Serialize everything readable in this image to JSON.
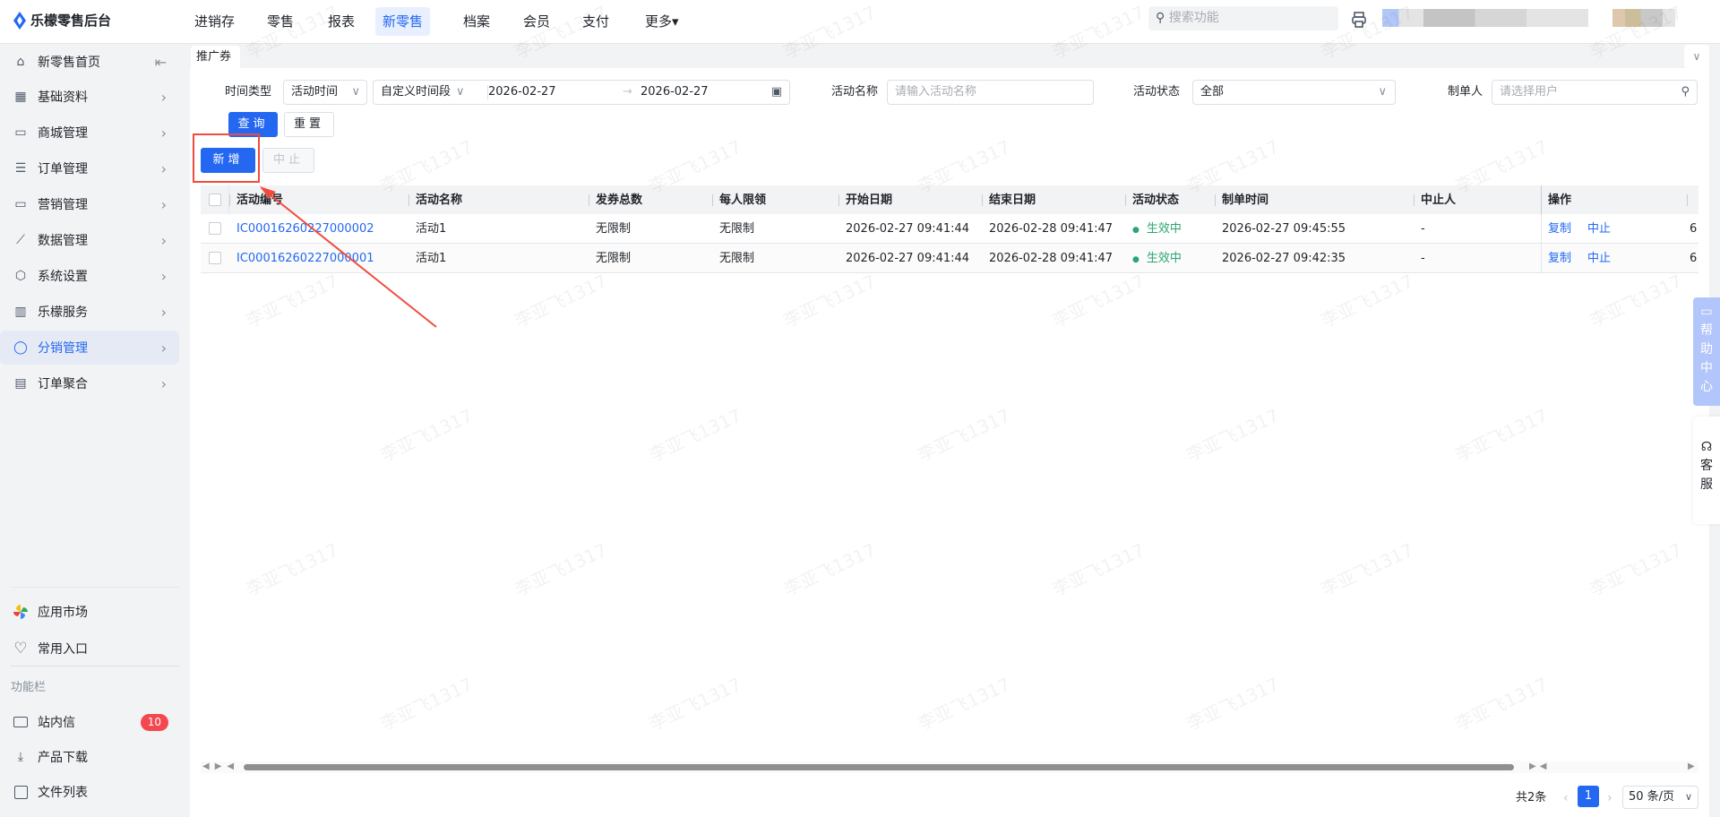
{
  "app": {
    "title": "乐檬零售后台"
  },
  "topnav": [
    {
      "label": "进销存"
    },
    {
      "label": "零售"
    },
    {
      "label": "报表"
    },
    {
      "label": "新零售",
      "active": true
    },
    {
      "label": "档案"
    },
    {
      "label": "会员"
    },
    {
      "label": "支付"
    },
    {
      "label": "更多▾"
    }
  ],
  "search": {
    "placeholder": "搜索功能"
  },
  "sidebar": {
    "items": [
      {
        "label": "新零售首页",
        "icon": "home-icon"
      },
      {
        "label": "基础资料",
        "icon": "grid-icon"
      },
      {
        "label": "商城管理",
        "icon": "store-icon"
      },
      {
        "label": "订单管理",
        "icon": "order-icon"
      },
      {
        "label": "营销管理",
        "icon": "marketing-icon"
      },
      {
        "label": "数据管理",
        "icon": "chart-icon"
      },
      {
        "label": "系统设置",
        "icon": "settings-icon"
      },
      {
        "label": "乐檬服务",
        "icon": "briefcase-icon"
      },
      {
        "label": "分销管理",
        "icon": "distribution-icon",
        "active": true
      },
      {
        "label": "订单聚合",
        "icon": "order-aggregate-icon"
      }
    ],
    "bottom": {
      "app_market": "应用市场",
      "favorites": "常用入口",
      "section": "功能栏",
      "messages": "站内信",
      "messages_badge": "10",
      "downloads": "产品下载",
      "files": "文件列表"
    }
  },
  "tab": {
    "label": "推广券"
  },
  "filters": {
    "time_type_label": "时间类型",
    "time_type_value": "活动时间",
    "range_type": "自定义时间段",
    "start_date": "2026-02-27",
    "end_date": "2026-02-27",
    "range_sep": "→",
    "name_label": "活动名称",
    "name_placeholder": "请输入活动名称",
    "status_label": "活动状态",
    "status_value": "全部",
    "creator_label": "制单人",
    "creator_placeholder": "请选择用户",
    "query": "查询",
    "reset": "重置"
  },
  "actions": {
    "add": "新增",
    "stop": "中止"
  },
  "table": {
    "columns": [
      "活动编号",
      "活动名称",
      "发券总数",
      "每人限领",
      "开始日期",
      "结束日期",
      "活动状态",
      "制单时间",
      "中止人",
      "操作"
    ],
    "rows": [
      {
        "id": "IC00016260227000002",
        "name": "活动1",
        "total": "无限制",
        "limit": "无限制",
        "start": "2026-02-27 09:41:44",
        "end": "2026-02-28 09:41:47",
        "status": "生效中",
        "created": "2026-02-27 09:45:55",
        "stopper": "-",
        "op1": "复制",
        "op2": "中止",
        "extra": "6"
      },
      {
        "id": "IC00016260227000001",
        "name": "活动1",
        "total": "无限制",
        "limit": "无限制",
        "start": "2026-02-27 09:41:44",
        "end": "2026-02-28 09:41:47",
        "status": "生效中",
        "created": "2026-02-27 09:42:35",
        "stopper": "-",
        "op1": "复制",
        "op2": "中止",
        "extra": "6"
      }
    ]
  },
  "pagination": {
    "total": "共2条",
    "current": "1",
    "page_size": "50 条/页"
  },
  "floater": {
    "help": "帮助中心",
    "service": "客服"
  },
  "watermark": "李亚飞1317",
  "colors": {
    "primary": "#2468f2",
    "status": "#2ba471",
    "annotation": "#f04c3e",
    "badge": "#f5474f"
  }
}
